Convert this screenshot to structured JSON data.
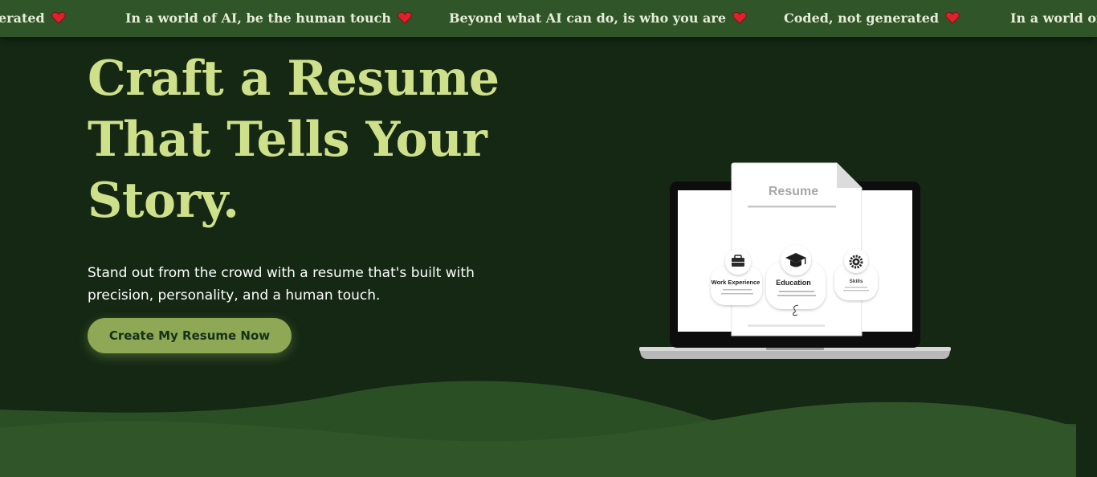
{
  "ticker": {
    "items": [
      "erated",
      "In a world of AI, be the human touch",
      "Beyond what AI can do, is who you are",
      "Coded, not generated",
      "In a world of"
    ]
  },
  "hero": {
    "title_lines": [
      "Craft a Resume",
      "That Tells Your",
      "Story."
    ],
    "subtitle_lines": [
      "Stand out from the crowd with a resume that's built with",
      "precision, personality, and a human touch."
    ],
    "cta_label": "Create My Resume Now"
  },
  "illustration": {
    "doc_title": "Resume",
    "sections": [
      "Work Experience",
      "Education",
      "Skills"
    ]
  },
  "colors": {
    "background": "#142814",
    "ticker_bg": "#2f5528",
    "title": "#cfe08a",
    "button": "#8ea856",
    "hill": "#2f5528"
  }
}
